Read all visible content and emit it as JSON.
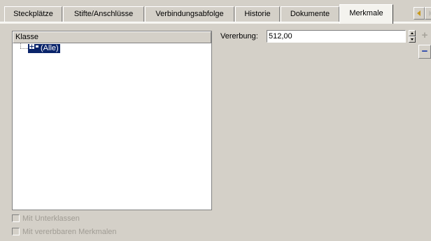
{
  "tabs": [
    {
      "label": "Steckplätze",
      "active": false
    },
    {
      "label": "Stifte/Anschlüsse",
      "active": false
    },
    {
      "label": "Verbindungsabfolge",
      "active": false
    },
    {
      "label": "Historie",
      "active": false
    },
    {
      "label": "Dokumente",
      "active": false
    },
    {
      "label": "Merkmale",
      "active": true
    }
  ],
  "tree": {
    "column_header": "Klasse",
    "root_node": "(Alle)"
  },
  "checkboxes": {
    "with_subclasses": {
      "label": "Mit Unterklassen",
      "checked": false,
      "enabled": false
    },
    "with_inheritable": {
      "label": "Mit vererbbaren Merkmalen",
      "checked": false,
      "enabled": false
    }
  },
  "inheritance": {
    "label": "Vererbung:",
    "value": "512,00"
  },
  "side_buttons": {
    "add_label": "+",
    "remove_label": "−"
  },
  "colors": {
    "face": "#d4d0c8",
    "selection": "#0a246a",
    "tab_arrow_active": "#c89a1e",
    "remove_button": "#1a3aa8"
  }
}
